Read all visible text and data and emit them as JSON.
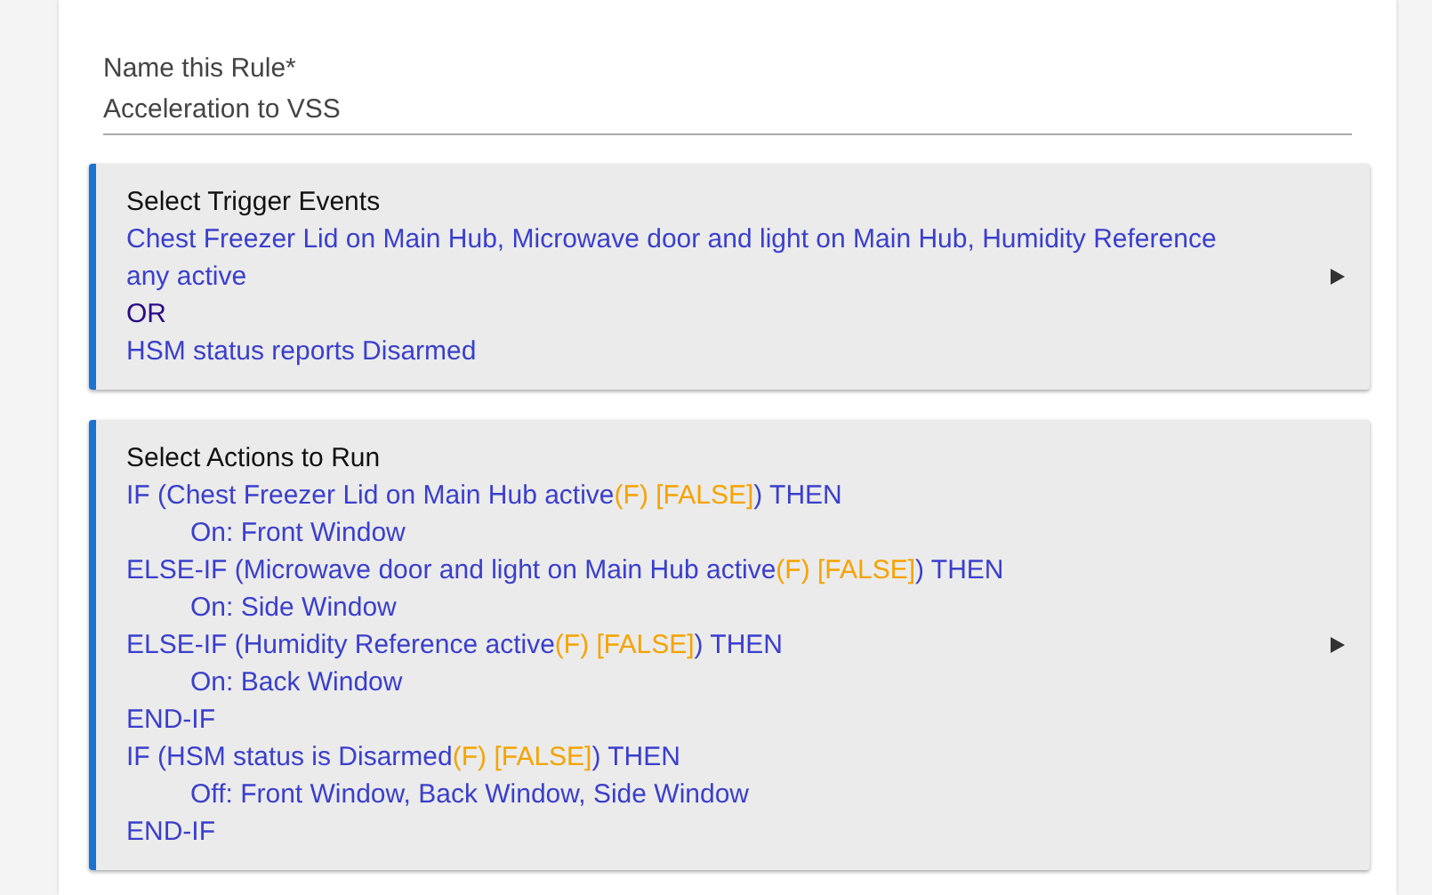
{
  "rule_name": {
    "label": "Name this Rule*",
    "value": "Acceleration to VSS"
  },
  "sections": [
    {
      "title": "Select Trigger Events",
      "lines": [
        {
          "segments": [
            {
              "kind": "plain",
              "text": "Chest Freezer Lid on Main Hub, Microwave door and light on Main Hub, Humidity Reference any active"
            }
          ]
        },
        {
          "segments": [
            {
              "kind": "operator",
              "text": "OR"
            }
          ]
        },
        {
          "segments": [
            {
              "kind": "plain",
              "text": "HSM status reports Disarmed"
            }
          ]
        }
      ]
    },
    {
      "title": "Select Actions to Run",
      "lines": [
        {
          "segments": [
            {
              "kind": "plain",
              "text": "IF (Chest Freezer Lid on Main Hub active"
            },
            {
              "kind": "state",
              "text": "(F) [FALSE]"
            },
            {
              "kind": "plain",
              "text": ") THEN"
            }
          ],
          "children": [
            {
              "segments": [
                {
                  "kind": "plain",
                  "text": "On: Front Window"
                }
              ]
            }
          ]
        },
        {
          "segments": [
            {
              "kind": "plain",
              "text": "ELSE-IF (Microwave door and light on Main Hub active"
            },
            {
              "kind": "state",
              "text": "(F) [FALSE]"
            },
            {
              "kind": "plain",
              "text": ") THEN"
            }
          ],
          "children": [
            {
              "segments": [
                {
                  "kind": "plain",
                  "text": "On: Side Window"
                }
              ]
            }
          ]
        },
        {
          "segments": [
            {
              "kind": "plain",
              "text": "ELSE-IF (Humidity Reference active"
            },
            {
              "kind": "state",
              "text": "(F) [FALSE]"
            },
            {
              "kind": "plain",
              "text": ") THEN"
            }
          ],
          "children": [
            {
              "segments": [
                {
                  "kind": "plain",
                  "text": "On: Back Window"
                }
              ]
            }
          ]
        },
        {
          "segments": [
            {
              "kind": "plain",
              "text": "END-IF"
            }
          ]
        },
        {
          "segments": [
            {
              "kind": "plain",
              "text": "IF (HSM status is Disarmed"
            },
            {
              "kind": "state",
              "text": "(F) [FALSE]"
            },
            {
              "kind": "plain",
              "text": ") THEN"
            }
          ],
          "children": [
            {
              "segments": [
                {
                  "kind": "plain",
                  "text": "Off: Front Window, Back Window, Side Window"
                }
              ]
            }
          ]
        },
        {
          "segments": [
            {
              "kind": "plain",
              "text": "END-IF"
            }
          ]
        }
      ]
    }
  ]
}
